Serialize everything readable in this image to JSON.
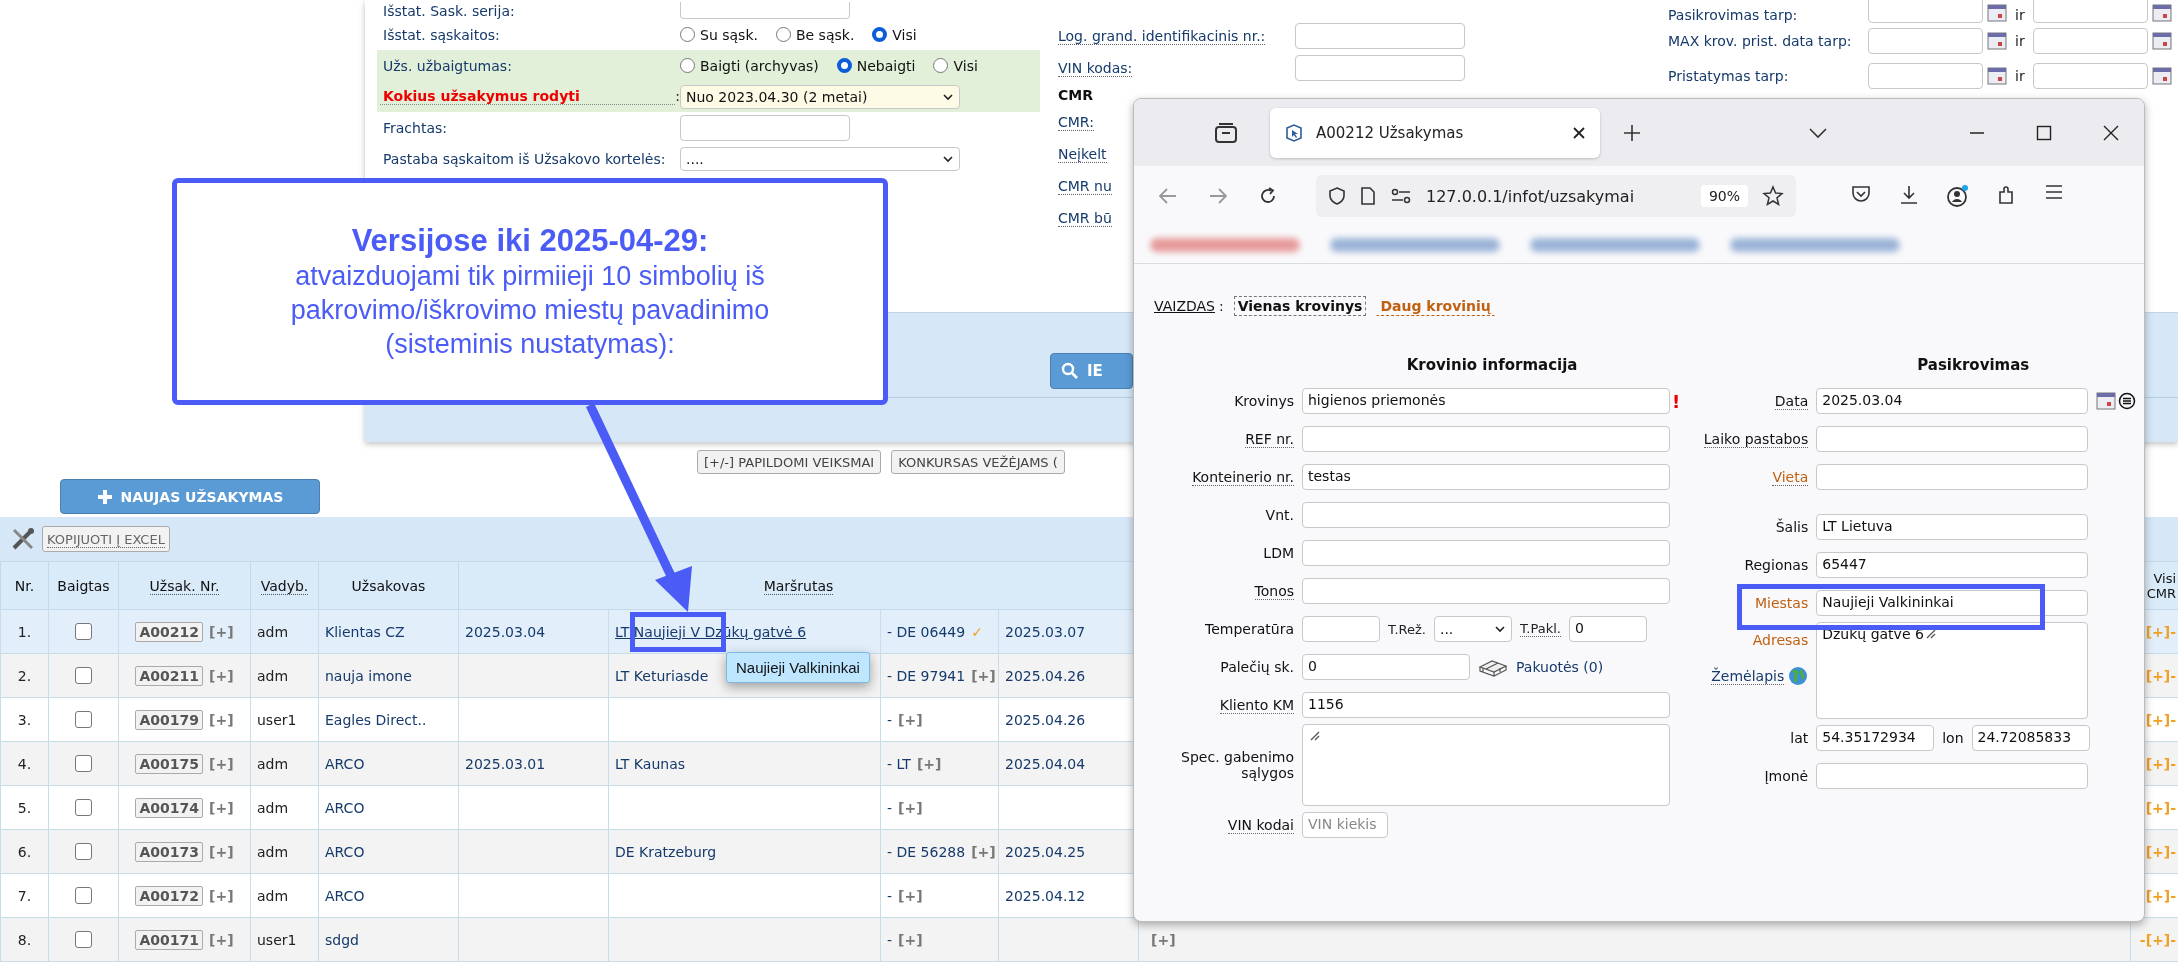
{
  "filters": {
    "rows": [
      {
        "kind": "text",
        "label": "Išstat. Sask. serija:"
      },
      {
        "kind": "radio",
        "label": "Išstat. sąskaitos:",
        "options": [
          {
            "label": "Su sąsk.",
            "selected": false
          },
          {
            "label": "Be sąsk.",
            "selected": false
          },
          {
            "label": "Visi",
            "selected": true
          }
        ]
      },
      {
        "kind": "radio",
        "label": "Užs. užbaigtumas:",
        "highlight": true,
        "options": [
          {
            "label": "Baigti (archyvas)",
            "selected": false
          },
          {
            "label": "Nebaigti",
            "selected": true
          },
          {
            "label": "Visi",
            "selected": false
          }
        ]
      },
      {
        "kind": "select",
        "label": "Kokius užsakymus rodyti",
        "suffix": ":",
        "emphasis": true,
        "highlight": true,
        "value": "Nuo 2023.04.30 (2 metai)"
      },
      {
        "kind": "text",
        "label": "Frachtas:"
      },
      {
        "kind": "select",
        "label": "Pastaba sąskaitom iš Užsakovo kortelės:",
        "value": "...."
      }
    ]
  },
  "extra_filters": [
    {
      "kind": "field",
      "label": "Log. grand. identifikacinis nr.:"
    },
    {
      "kind": "field",
      "label": "VIN kodas:"
    },
    {
      "kind": "heading",
      "label": "CMR"
    },
    {
      "kind": "link",
      "label": "CMR:"
    },
    {
      "kind": "link",
      "label": "Neįkelt"
    },
    {
      "kind": "link",
      "label": "CMR nu"
    },
    {
      "kind": "link",
      "label": "CMR bū"
    }
  ],
  "date_ranges": [
    {
      "label": "Pasikrovimas tarp:",
      "joiner": "ir"
    },
    {
      "label": "MAX krov. prist. data tarp:",
      "joiner": "ir"
    },
    {
      "label": "Pristatymas tarp:",
      "joiner": "ir"
    }
  ],
  "search_button": "IE",
  "actions": [
    "[+/-] PAPILDOMI VEIKSMAI",
    "KONKURSAS VEŽĖJAMS ("
  ],
  "new_order_button": "NAUJAS UŽSAKYMAS",
  "export_button": "KOPIJUOTI Į EXCEL",
  "orders": {
    "columns": [
      "Nr.",
      "Baigtas",
      "Užsak. Nr.",
      "Vadyb.",
      "Užsakovas",
      "Maršrutas",
      "Visi CMR"
    ],
    "rows": [
      {
        "nr": "1.",
        "done": false,
        "selected": true,
        "id": "A00212",
        "add": "[+]",
        "manager": "adm",
        "client": "Klientas CZ",
        "load_date": "2025.03.04",
        "from": "LT Naujieji V Dzūkų gatvė 6",
        "to": "- DE 06449",
        "to_mark": {
          "kind": "check",
          "text": "✓"
        },
        "unload_date": "2025.03.07",
        "cmr": "[+]-"
      },
      {
        "nr": "2.",
        "done": false,
        "selected": false,
        "id": "A00211",
        "add": "[+]",
        "manager": "adm",
        "client": "nauja imone",
        "from": "LT Keturiasde",
        "to": "- DE 97941",
        "to_mark": {
          "kind": "plus",
          "text": "[+]"
        },
        "unload_date": "2025.04.26",
        "cmr": "[+]-"
      },
      {
        "nr": "3.",
        "done": false,
        "selected": false,
        "id": "A00179",
        "add": "[+]",
        "manager": "user1",
        "client": "Eagles Direct..",
        "to": "-",
        "to_mark": {
          "kind": "plus",
          "text": "[+]"
        },
        "unload_date": "2025.04.26",
        "cmr": "[+]-"
      },
      {
        "nr": "4.",
        "done": false,
        "selected": false,
        "id": "A00175",
        "add": "[+]",
        "manager": "adm",
        "client": "ARCO",
        "load_date": "2025.03.01",
        "from": "LT Kaunas",
        "to": "- LT",
        "to_mark": {
          "kind": "plus",
          "text": "[+]"
        },
        "unload_date": "2025.04.04",
        "cmr": "[+]-"
      },
      {
        "nr": "5.",
        "done": false,
        "selected": false,
        "id": "A00174",
        "add": "[+]",
        "manager": "adm",
        "client": "ARCO",
        "to": "-",
        "to_mark": {
          "kind": "plus",
          "text": "[+]"
        },
        "cmr": "[+]-"
      },
      {
        "nr": "6.",
        "done": false,
        "selected": false,
        "id": "A00173",
        "add": "[+]",
        "manager": "adm",
        "client": "ARCO",
        "from": "DE Kratzeburg",
        "to": "- DE 56288",
        "to_mark": {
          "kind": "plus",
          "text": "[+]"
        },
        "unload_date": "2025.04.25",
        "cmr": "[+]-"
      },
      {
        "nr": "7.",
        "done": false,
        "selected": false,
        "id": "A00172",
        "add": "[+]",
        "manager": "adm",
        "client": "ARCO",
        "to": "-",
        "to_mark": {
          "kind": "plus",
          "text": "[+]"
        },
        "unload_date": "2025.04.12",
        "cmr": "[+]-"
      },
      {
        "nr": "8.",
        "done": false,
        "selected": false,
        "id": "A00171",
        "add": "[+]",
        "manager": "user1",
        "client": "sdgd",
        "to": "-",
        "to_mark": {
          "kind": "plus",
          "text": "[+]"
        },
        "extra": "[+]",
        "cmr": "-[+]-"
      }
    ]
  },
  "browser": {
    "tab_title": "A00212 Užsakymas",
    "url": "127.0.0.1/infot/uzsakymai",
    "zoom": "90%",
    "view": {
      "label": "VAIZDAS",
      "separator": ":",
      "options": [
        {
          "label": "Vienas krovinys",
          "selected": true
        },
        {
          "label": "Daug krovinių",
          "selected": false
        }
      ]
    },
    "cargo": {
      "title": "Krovinio informacija",
      "rows": [
        {
          "kind": "text",
          "label": "Krovinys",
          "value": "higienos priemonės",
          "warning": "!"
        },
        {
          "kind": "text",
          "label": "REF nr.",
          "dotted": true
        },
        {
          "kind": "text",
          "label": "Konteinerio nr.",
          "dotted": true,
          "value": "testas"
        },
        {
          "kind": "text",
          "label": "Vnt."
        },
        {
          "kind": "text",
          "label": "LDM"
        },
        {
          "kind": "text",
          "label": "Tonos",
          "dotted": true
        },
        {
          "kind": "temperature",
          "label": "Temperatūra",
          "mode_label": "T.Rež.",
          "mode_value": "...",
          "tolerance_label": "T.Pakl.",
          "tolerance_value": "0"
        },
        {
          "kind": "pallets",
          "label": "Palečių sk.",
          "value": "0",
          "link": "Pakuotės (0)"
        },
        {
          "kind": "text",
          "label": "Kliento KM",
          "dotted": true,
          "value": "1156"
        },
        {
          "kind": "textarea",
          "label": "Spec. gabenimo sąlygos"
        },
        {
          "kind": "vin",
          "label": "VIN kodai",
          "dotted": true,
          "placeholder": "VIN kiekis"
        }
      ]
    },
    "loading": {
      "title": "Pasikrovimas",
      "rows": [
        {
          "kind": "date",
          "label": "Data",
          "dotted": true,
          "value": "2025.03.04"
        },
        {
          "kind": "text",
          "label": "Laiko pastabos",
          "dotted": true
        },
        {
          "kind": "text",
          "label": "Vieta",
          "dotted": true,
          "accent": true
        },
        {
          "kind": "text",
          "label": "Šalis",
          "value": "LT Lietuva",
          "gap": true
        },
        {
          "kind": "text",
          "label": "Regionas",
          "value": "65447"
        },
        {
          "kind": "text",
          "label": "Miestas",
          "accent": true,
          "value": "Naujieji Valkininkai"
        },
        {
          "kind": "address",
          "label": "Adresas",
          "accent": true,
          "value": "Dzūkų gatvė 6",
          "map_link": "Žemėlapis"
        },
        {
          "kind": "coords",
          "label": "lat",
          "value": "54.35172934",
          "label2": "lon",
          "value2": "24.72085833"
        },
        {
          "kind": "text",
          "label": "Įmonė"
        }
      ]
    }
  },
  "callout": {
    "title": "Versijose iki 2025-04-29:",
    "body": "atvaizduojami tik pirmiieji 10 simbolių iš pakrovimo/iškrovimo miestų pavadinimo (sisteminis nustatymas):"
  },
  "tooltip": "Naujieji Valkininkai"
}
